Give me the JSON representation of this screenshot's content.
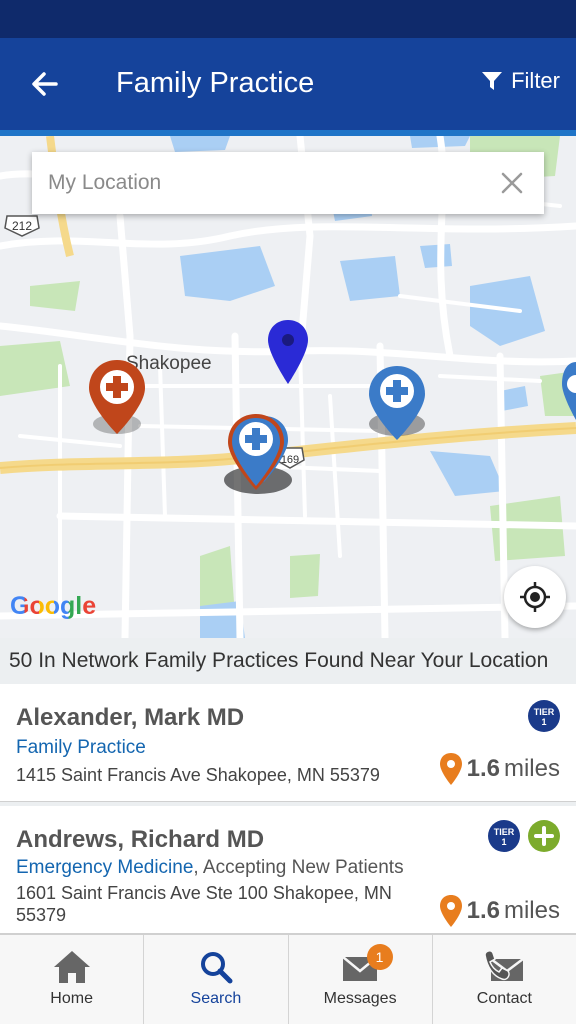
{
  "header": {
    "title": "Family Practice",
    "filter_label": "Filter"
  },
  "search": {
    "placeholder": "My Location",
    "value": ""
  },
  "map": {
    "attribution": "Google",
    "place_label": "Shakopee",
    "route_shields": [
      "212",
      "169"
    ]
  },
  "results": {
    "summary": "50 In Network Family Practices Found Near Your Location"
  },
  "providers": [
    {
      "name": "Alexander, Mark MD",
      "specialty": "Family Practice",
      "extra": "",
      "address": "1415 Saint Francis Ave Shakopee, MN 55379",
      "distance_value": "1.6",
      "distance_unit": "miles",
      "tier_label": "TIER",
      "tier_number": "1"
    },
    {
      "name": "Andrews, Richard MD",
      "specialty": "Emergency Medicine",
      "extra": ", Accepting New Patients",
      "address": "1601 Saint Francis Ave Ste 100 Shakopee, MN 55379",
      "distance_value": "1.6",
      "distance_unit": "miles",
      "tier_label": "TIER",
      "tier_number": "1"
    }
  ],
  "nav": {
    "items": [
      {
        "label": "Home",
        "icon": "home-icon"
      },
      {
        "label": "Search",
        "icon": "search-icon"
      },
      {
        "label": "Messages",
        "icon": "mail-icon",
        "badge": "1"
      },
      {
        "label": "Contact",
        "icon": "contact-icon"
      }
    ]
  },
  "colors": {
    "app_bar": "#15439b",
    "status_bar": "#0f2a6b",
    "accent": "#1466b0",
    "pin_orange": "#e87d1e",
    "pin_blue": "#3b7bc8",
    "pin_red": "#c0461b"
  }
}
